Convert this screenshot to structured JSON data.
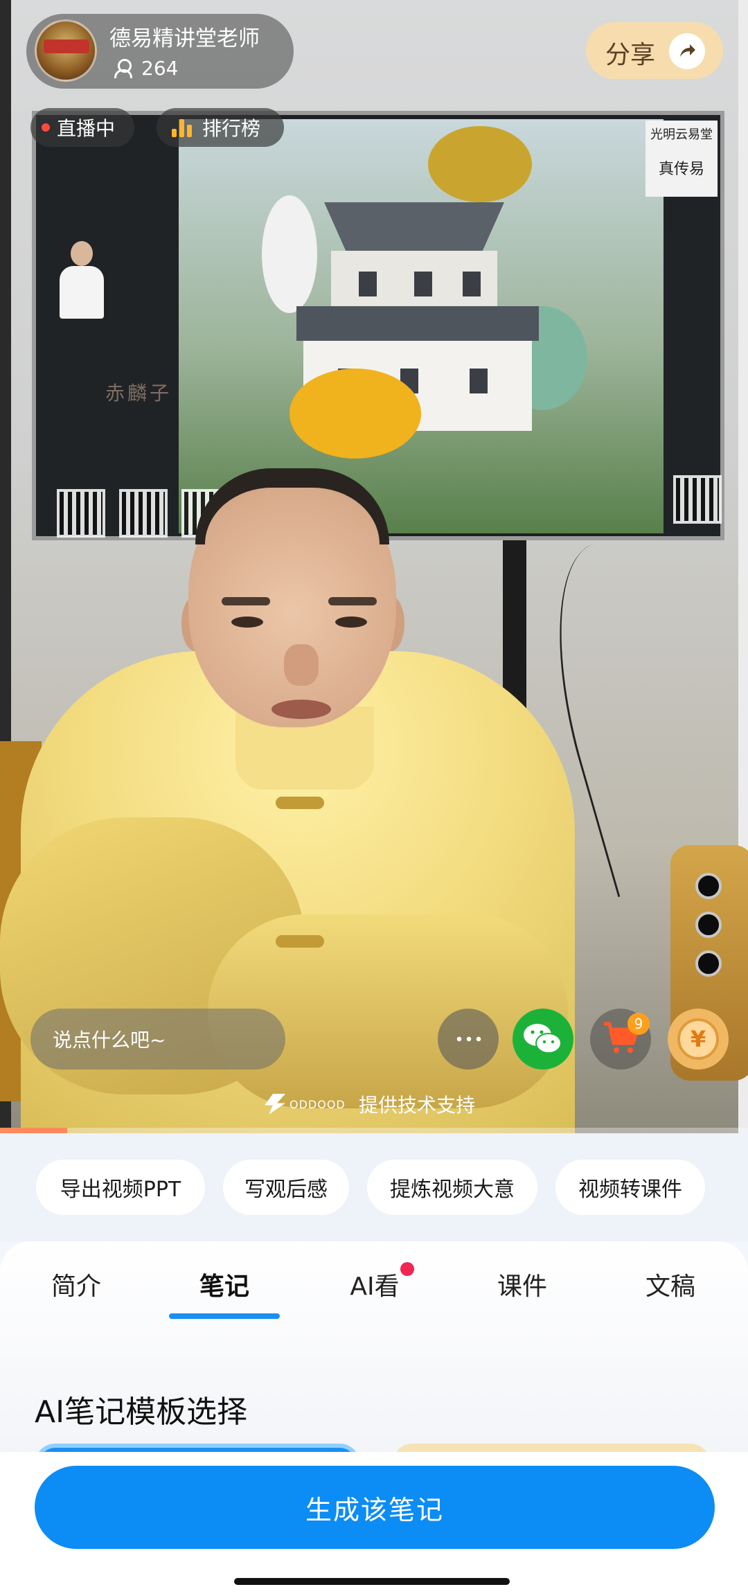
{
  "host": {
    "name": "德易精讲堂老师",
    "viewers": "264"
  },
  "share": {
    "label": "分享"
  },
  "status": {
    "live_label": "直播中",
    "rank_label": "排行榜"
  },
  "video_overlay": {
    "comment_placeholder": "说点什么吧~",
    "cart_badge": "9",
    "gift_symbol": "¥",
    "tech_logo_text": "ODDOOD",
    "tech_support": "提供技术支持",
    "screen_brand": "光明云易堂",
    "screen_brand_sub": "真传易",
    "screen_sign": "赤麟子",
    "progress": 0.09
  },
  "actions": [
    {
      "label": "导出视频PPT"
    },
    {
      "label": "写观后感"
    },
    {
      "label": "提炼视频大意"
    },
    {
      "label": "视频转课件"
    }
  ],
  "tabs": [
    {
      "label": "简介"
    },
    {
      "label": "笔记",
      "active": true
    },
    {
      "label": "AI看",
      "has_dot": true
    },
    {
      "label": "课件"
    },
    {
      "label": "文稿"
    }
  ],
  "notes": {
    "section_title": "AI笔记模板选择"
  },
  "bottom": {
    "generate_label": "生成该笔记"
  },
  "colors": {
    "accent": "#0c8cf5",
    "tab_underline": "#1b8ff0",
    "live_dot": "#ff4a3d",
    "rank_icon": "#ffb52e",
    "share_bg": "#f7dcae",
    "wechat": "#1cb23a",
    "notification_dot": "#f02553"
  }
}
